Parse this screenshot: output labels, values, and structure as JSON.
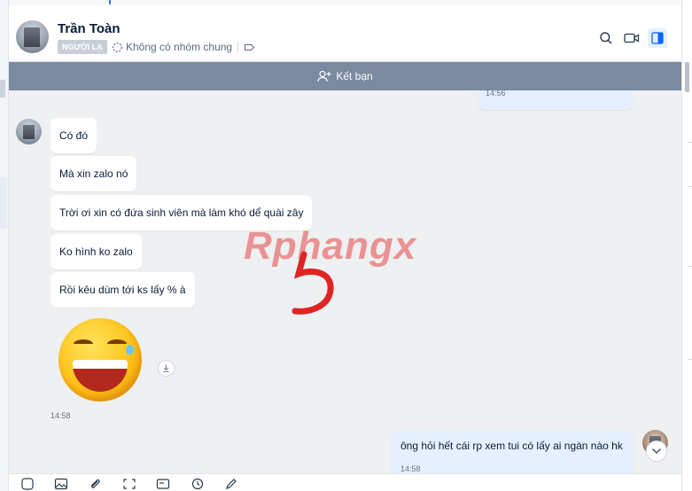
{
  "header": {
    "contact_name": "Trần Toàn",
    "badge": "NGƯỜI LẠ",
    "group_text": "Không có nhóm chung",
    "icons": [
      "search-icon",
      "video-call-icon",
      "sidebar-toggle-icon"
    ]
  },
  "friend_bar": {
    "label": "Kết bạn",
    "icon": "add-friend-icon"
  },
  "messages": {
    "prev_time": "14:56",
    "incoming": [
      "Có đó",
      "Mà xin zalo nó",
      "Trời ơi xin có đứa sinh viên mà làm khó dể quài zây",
      "Ko hình ko zalo",
      "Rồi kêu dùm tới ks lấy % à"
    ],
    "sticker": "laughing-tears-emoji",
    "incoming_time": "14:58",
    "outgoing_text": "ông hỏi hết cái rp xem tui có lấy ai ngàn nào hk",
    "outgoing_time": "14:58"
  },
  "watermark": {
    "text": "Rphangx",
    "number": "5"
  },
  "toolbar": {
    "icons": [
      "sticker-icon",
      "image-icon",
      "attachment-icon",
      "screenshot-icon",
      "business-card-icon",
      "reminder-icon",
      "draw-icon"
    ]
  },
  "colors": {
    "friend_bar": "#7a8aa0",
    "outgoing_bubble": "#e5efff",
    "chat_background": "#eef0f1",
    "watermark_red": "#e02424"
  }
}
